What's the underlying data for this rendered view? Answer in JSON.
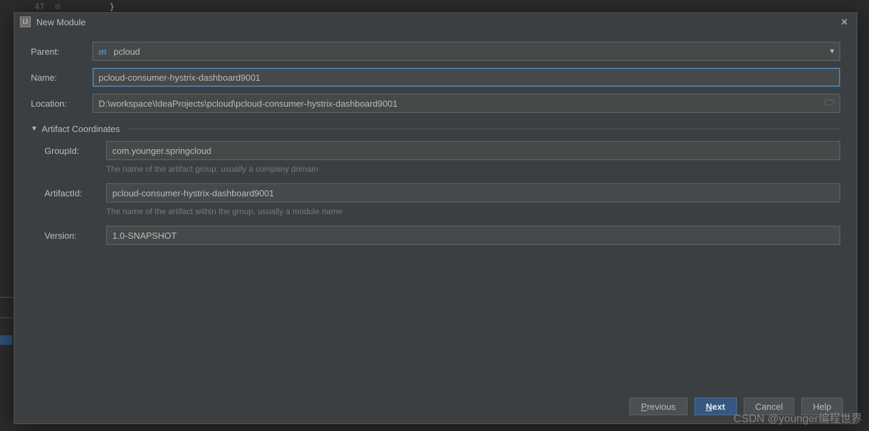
{
  "editor": {
    "line_number": "47",
    "code": "}"
  },
  "dialog": {
    "title": "New Module",
    "parent_label": "Parent:",
    "parent_value": "pcloud",
    "name_label": "Name:",
    "name_value": "pcloud-consumer-hystrix-dashboard9001",
    "location_label": "Location:",
    "location_value": "D:\\workspace\\IdeaProjects\\pcloud\\pcloud-consumer-hystrix-dashboard9001",
    "artifact_section": "Artifact Coordinates",
    "groupid_label": "GroupId:",
    "groupid_value": "com.younger.springcloud",
    "groupid_hint": "The name of the artifact group, usually a company domain",
    "artifactid_label": "ArtifactId:",
    "artifactid_value": "pcloud-consumer-hystrix-dashboard9001",
    "artifactid_hint": "The name of the artifact within the group, usually a module name",
    "version_label": "Version:",
    "version_value": "1.0-SNAPSHOT"
  },
  "buttons": {
    "previous": "revious",
    "next": "ext",
    "cancel": "Cancel",
    "help": "Help"
  },
  "watermark": "CSDN @younger编程世界"
}
